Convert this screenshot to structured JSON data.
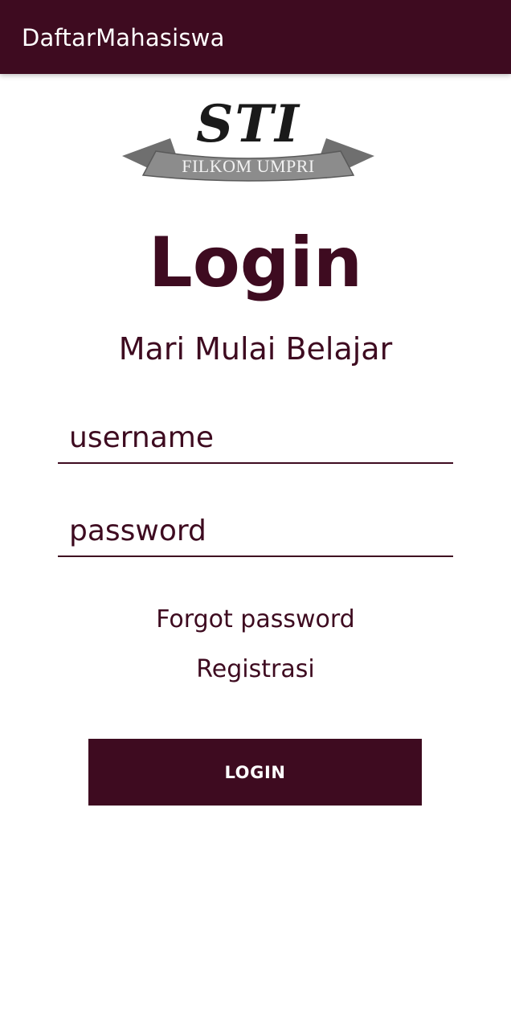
{
  "app_bar": {
    "title": "DaftarMahasiswa"
  },
  "logo": {
    "top_text": "STI",
    "banner_text": "FILKOM UMPRI"
  },
  "main": {
    "title": "Login",
    "subtitle": "Mari Mulai Belajar",
    "username": {
      "value": "",
      "placeholder": "username"
    },
    "password": {
      "value": "",
      "placeholder": "password"
    },
    "forgot_password_label": "Forgot password",
    "register_label": "Registrasi",
    "login_button_label": "LOGIN"
  },
  "colors": {
    "primary": "#3e0b20",
    "banner_grey": "#8a8a8a",
    "background": "#ffffff"
  }
}
